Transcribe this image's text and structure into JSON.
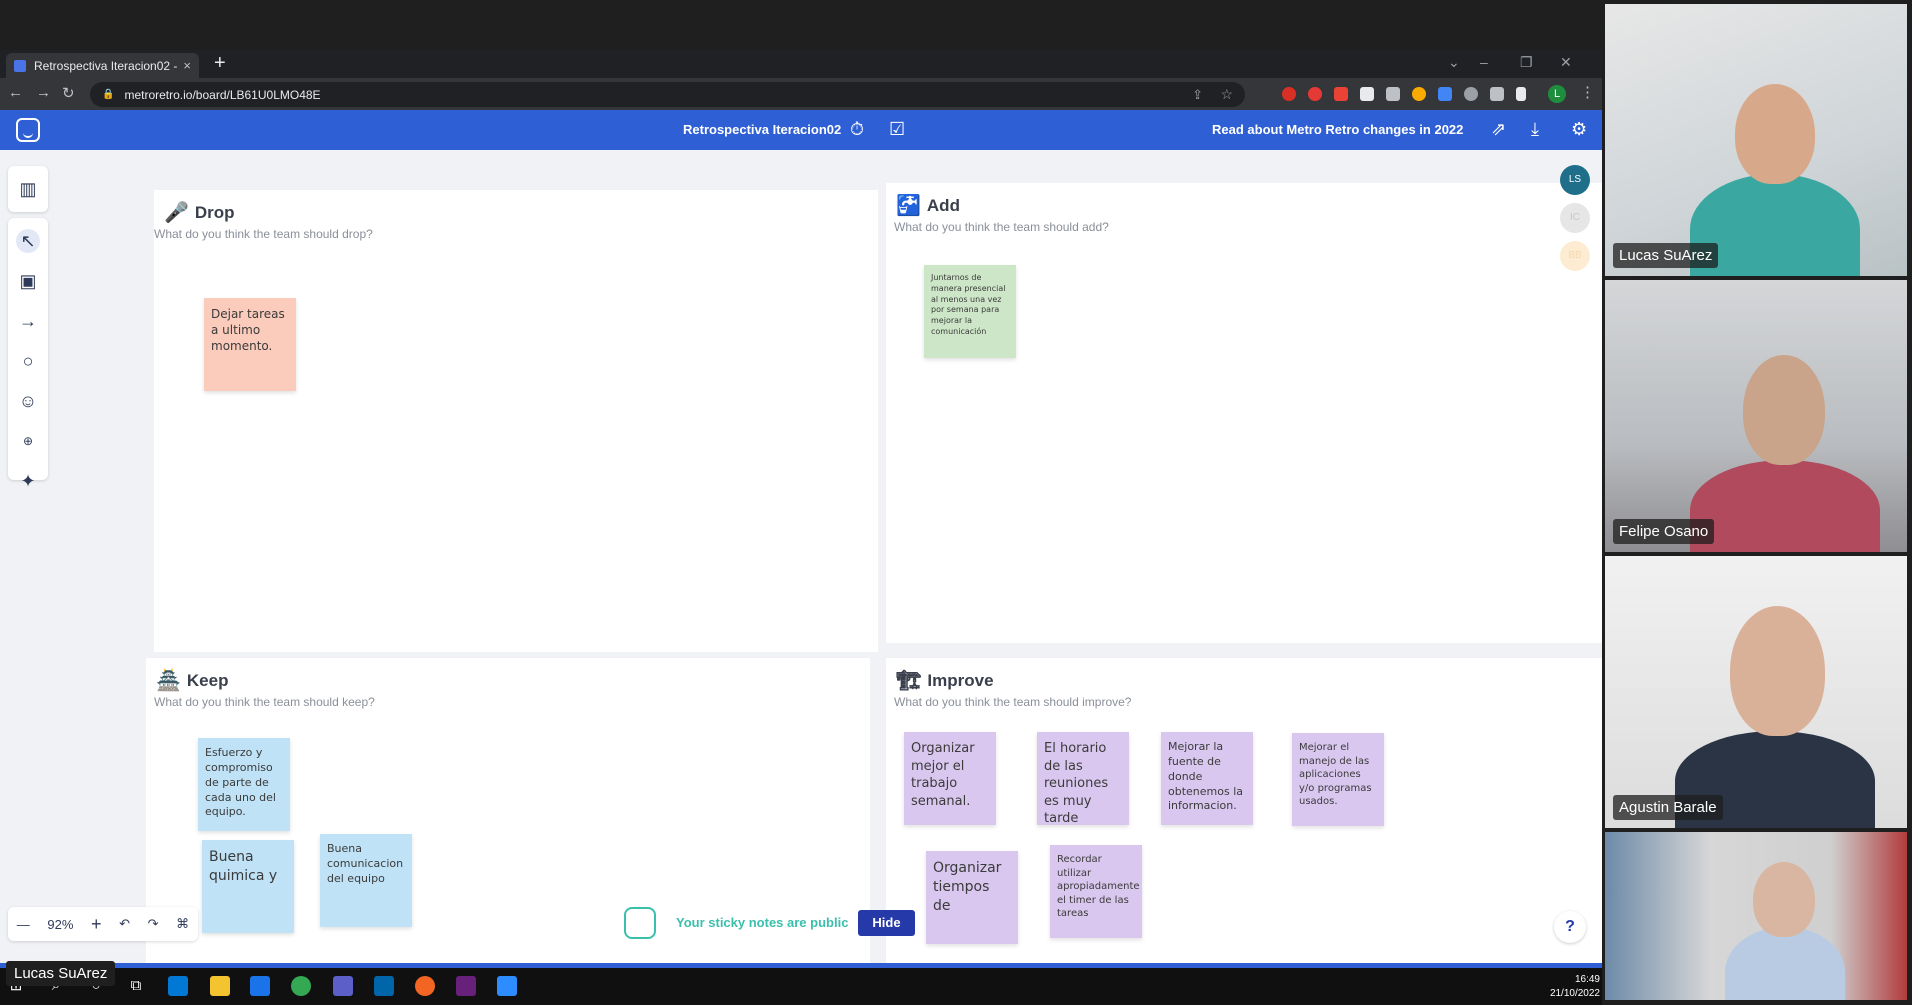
{
  "browser": {
    "tab_title": "Retrospectiva Iteracion02 - Metro",
    "url": "metroretro.io/board/LB61U0LMO48E",
    "new_tab": "+",
    "close": "×",
    "back": "←",
    "forward": "→",
    "reload": "↻",
    "profile_letter": "L"
  },
  "app": {
    "board_title": "Retrospectiva Iteracion02",
    "changes_link": "Read about Metro Retro changes in 2022"
  },
  "columns": {
    "drop": {
      "title": "Drop",
      "subtitle": "What do you think the team should drop?",
      "notes": [
        "Dejar tareas a ultimo momento."
      ]
    },
    "add": {
      "title": "Add",
      "subtitle": "What do you think the team should add?",
      "notes": [
        "Juntarnos de manera presencial al menos una vez por semana para mejorar la comunicación"
      ]
    },
    "keep": {
      "title": "Keep",
      "subtitle": "What do you think the team should keep?",
      "notes": [
        "Esfuerzo y compromiso de parte de cada uno del equipo.",
        "Buena quimica y",
        "Buena comunicacion del equipo"
      ]
    },
    "improve": {
      "title": "Improve",
      "subtitle": "What do you think the team should improve?",
      "notes": [
        "Organizar mejor el trabajo semanal.",
        "El horario de las reuniones es muy tarde",
        "Mejorar la fuente de donde obtenemos la informacion.",
        "Mejorar el manejo de las aplicaciones y/o programas usados.",
        "Organizar tiempos de",
        "Recordar utilizar apropiadamente el timer de las tareas"
      ]
    }
  },
  "avatars": [
    "LS",
    "IC",
    "BB"
  ],
  "zoom": {
    "minus": "—",
    "value": "92%",
    "plus": "+"
  },
  "notice": {
    "text": "Your sticky notes are public",
    "hide": "Hide"
  },
  "help": "?",
  "taskbar": {
    "time": "16:49",
    "date": "21/10/2022"
  },
  "participants": [
    "Lucas SuArez",
    "Felipe Osano",
    "Agustin Barale"
  ],
  "self_name": "Lucas SuArez",
  "colors": {
    "header_blue": "#2f5fd4",
    "sticky_pink": "#fbcbbb",
    "sticky_green": "#cde6c7",
    "sticky_blue": "#bfe2f6",
    "sticky_purple": "#d9c7ef",
    "teams_active": "#7b83eb"
  }
}
